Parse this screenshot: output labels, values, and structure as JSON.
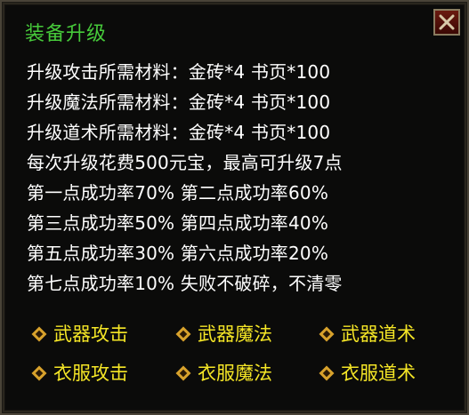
{
  "title": "装备升级",
  "icons": {
    "close": "close-x-icon",
    "option_bullet": "diamond-bullet-icon"
  },
  "colors": {
    "title": "#46c93a",
    "text": "#ffffff",
    "option": "#f5e626",
    "bullet": "#d8a22c"
  },
  "info_lines": [
    "升级攻击所需材料：金砖*4 书页*100",
    "升级魔法所需材料：金砖*4 书页*100",
    "升级道术所需材料：金砖*4 书页*100",
    "每次升级花费500元宝，最高可升级7点",
    "第一点成功率70% 第二点成功率60%",
    "第三点成功率50% 第四点成功率40%",
    "第五点成功率30% 第六点成功率20%",
    "第七点成功率10% 失败不破碎，不清零"
  ],
  "options": [
    "武器攻击",
    "武器魔法",
    "武器道术",
    "衣服攻击",
    "衣服魔法",
    "衣服道术"
  ]
}
